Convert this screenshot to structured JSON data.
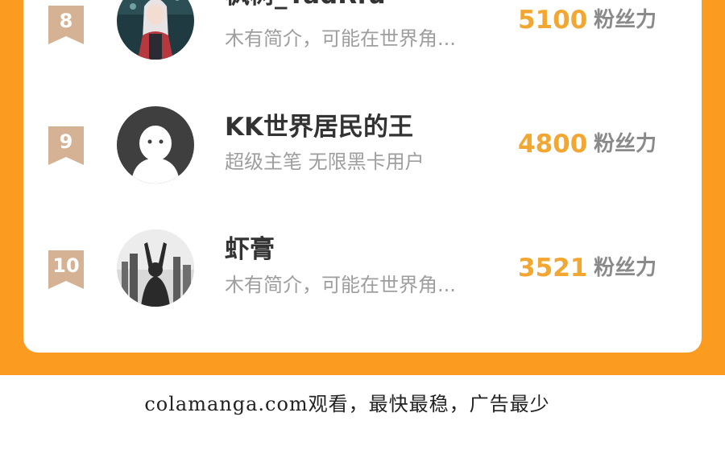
{
  "ranking": {
    "entries": [
      {
        "rank": "8",
        "name": "枫树_YadRfu",
        "bio": "木有简介，可能在世界角...",
        "fans": "5100",
        "fans_label": "粉丝力"
      },
      {
        "rank": "9",
        "name": "KK世界居民的王",
        "bio": "超级主笔 无限黑卡用户",
        "fans": "4800",
        "fans_label": "粉丝力"
      },
      {
        "rank": "10",
        "name": "虾膏",
        "bio": "木有简介，可能在世界角...",
        "fans": "3521",
        "fans_label": "粉丝力"
      }
    ]
  },
  "footer": {
    "text": "colamanga.com观看，最快最稳，广告最少"
  },
  "colors": {
    "background_orange": "#fb9b20",
    "fans_value": "#f2a733",
    "badge": "#d6b294"
  }
}
